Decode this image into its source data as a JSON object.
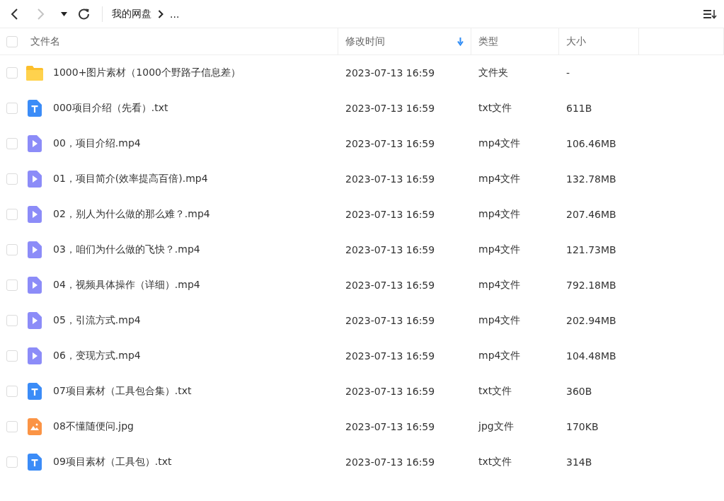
{
  "toolbar": {
    "breadcrumb": [
      "我的网盘",
      "..."
    ],
    "forward_disabled": true
  },
  "table": {
    "select_all": {
      "checked": false
    },
    "columns": [
      {
        "label": "文件名",
        "sorted": false
      },
      {
        "label": "修改时间",
        "sorted": true
      },
      {
        "label": "类型",
        "sorted": false
      },
      {
        "label": "大小",
        "sorted": false
      }
    ],
    "rows": [
      {
        "kind": "folder",
        "name": "1000+图片素材（1000个野路子信息差）",
        "modified": "2023-07-13 16:59",
        "type": "文件夹",
        "size": "-",
        "checked": false
      },
      {
        "kind": "txt",
        "name": "000项目介绍（先看）.txt",
        "modified": "2023-07-13 16:59",
        "type": "txt文件",
        "size": "611B",
        "checked": false
      },
      {
        "kind": "video",
        "name": "00，项目介绍.mp4",
        "modified": "2023-07-13 16:59",
        "type": "mp4文件",
        "size": "106.46MB",
        "checked": false
      },
      {
        "kind": "video",
        "name": "01，项目简介(效率提高百倍).mp4",
        "modified": "2023-07-13 16:59",
        "type": "mp4文件",
        "size": "132.78MB",
        "checked": false
      },
      {
        "kind": "video",
        "name": "02，别人为什么做的那么难？.mp4",
        "modified": "2023-07-13 16:59",
        "type": "mp4文件",
        "size": "207.46MB",
        "checked": false
      },
      {
        "kind": "video",
        "name": "03，咱们为什么做的飞快？.mp4",
        "modified": "2023-07-13 16:59",
        "type": "mp4文件",
        "size": "121.73MB",
        "checked": false
      },
      {
        "kind": "video",
        "name": "04，视频具体操作（详细）.mp4",
        "modified": "2023-07-13 16:59",
        "type": "mp4文件",
        "size": "792.18MB",
        "checked": false
      },
      {
        "kind": "video",
        "name": "05，引流方式.mp4",
        "modified": "2023-07-13 16:59",
        "type": "mp4文件",
        "size": "202.94MB",
        "checked": false
      },
      {
        "kind": "video",
        "name": "06，变现方式.mp4",
        "modified": "2023-07-13 16:59",
        "type": "mp4文件",
        "size": "104.48MB",
        "checked": false
      },
      {
        "kind": "txt",
        "name": "07项目素材（工具包合集）.txt",
        "modified": "2023-07-13 16:59",
        "type": "txt文件",
        "size": "360B",
        "checked": false
      },
      {
        "kind": "image",
        "name": "08不懂随便问.jpg",
        "modified": "2023-07-13 16:59",
        "type": "jpg文件",
        "size": "170KB",
        "checked": false
      },
      {
        "kind": "txt",
        "name": "09项目素材（工具包）.txt",
        "modified": "2023-07-13 16:59",
        "type": "txt文件",
        "size": "314B",
        "checked": false
      }
    ]
  }
}
